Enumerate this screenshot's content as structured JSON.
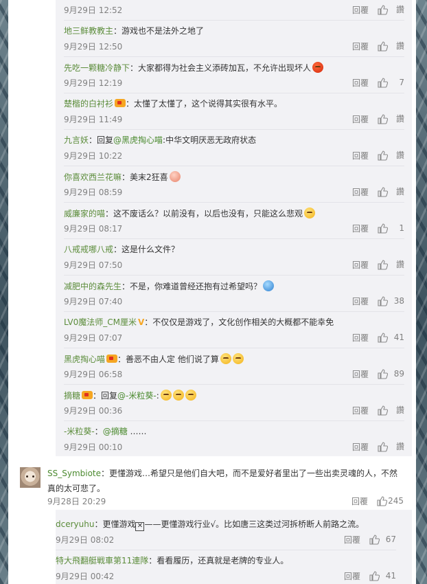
{
  "comments": [
    {
      "name": "",
      "text": "",
      "time": "9月29日 12:52",
      "reply": "回覆",
      "likes": "讚"
    },
    {
      "name": "地三鲜教教主",
      "text": "：游戏也不是法外之地了",
      "time": "9月29日 12:50",
      "reply": "回覆",
      "likes": "讚"
    },
    {
      "name": "先吃一颗糖冷静下",
      "text": "：大家都得为社会主义添砖加瓦，不允许出现坏人",
      "time": "9月29日 12:19",
      "reply": "回覆",
      "likes": "7"
    },
    {
      "name": "楚楷的白衬衫",
      "text": "：太懂了太懂了，这个说得其实很有水平。",
      "time": "9月29日 11:49",
      "reply": "回覆",
      "likes": "讚"
    },
    {
      "name": "九言妖",
      "text_pre": "：回复",
      "mention": "@黑虎掏心喵",
      "text": ":中华文明厌恶无政府状态",
      "time": "9月29日 10:22",
      "reply": "回覆",
      "likes": "讚"
    },
    {
      "name": "你喜欢西兰花嘛",
      "text": "：美末2狂喜",
      "time": "9月29日 08:59",
      "reply": "回覆",
      "likes": "讚"
    },
    {
      "name": "威廉家的喵",
      "text": "：这不废话么？以前没有，以后也没有，只能这么悲观",
      "time": "9月29日 08:17",
      "reply": "回覆",
      "likes": "1"
    },
    {
      "name": "八戒戒哪八戒",
      "text": "：这是什么文件？",
      "time": "9月29日 07:50",
      "reply": "回覆",
      "likes": "讚"
    },
    {
      "name": "减肥中的森先生",
      "text": "：不是，你难道曾经还抱有过希望吗？",
      "time": "9月29日 07:40",
      "reply": "回覆",
      "likes": "38"
    },
    {
      "name": "LV0魔法师_CM厘米",
      "text": "：不仅仅是游戏了，文化创作相关的大概都不能幸免",
      "time": "9月29日 07:07",
      "reply": "回覆",
      "likes": "41"
    },
    {
      "name": "黑虎掏心喵",
      "text": "：善恶不由人定 他们说了算",
      "time": "9月29日 06:58",
      "reply": "回覆",
      "likes": "89"
    },
    {
      "name": "摘糖",
      "text_pre": "：回复",
      "mention": "@-米粒葵-",
      "text": ":",
      "time": "9月29日 00:36",
      "reply": "回覆",
      "likes": "讚"
    },
    {
      "name": "-米粒葵-",
      "text_pre": "：",
      "mention": "@摘糖",
      "text": " ……",
      "time": "9月29日 00:10",
      "reply": "回覆",
      "likes": "讚"
    }
  ],
  "main_comment": {
    "name": "SS_Symbiote",
    "text": "：更懂游戏…希望只是他们自大吧，而不是爱好者里出了一些出卖灵魂的人，不然真的太可悲了。",
    "time": "9月28日 20:29",
    "reply": "回覆",
    "likes": "245"
  },
  "sub_comments": [
    {
      "name": "dceryuhu",
      "text_a": "：更懂游戏",
      "text_b": "——更懂游戏行业√。比如唐三这类过河拆桥断人前路之流。",
      "time": "9月29日 08:02",
      "reply": "回覆",
      "likes": "67"
    },
    {
      "name": "特大飛翻艇戦車第11連隊",
      "text": "：看看履历，还真就是老牌的专业人。",
      "time": "9月29日 00:42",
      "reply": "回覆",
      "likes": "41"
    }
  ]
}
